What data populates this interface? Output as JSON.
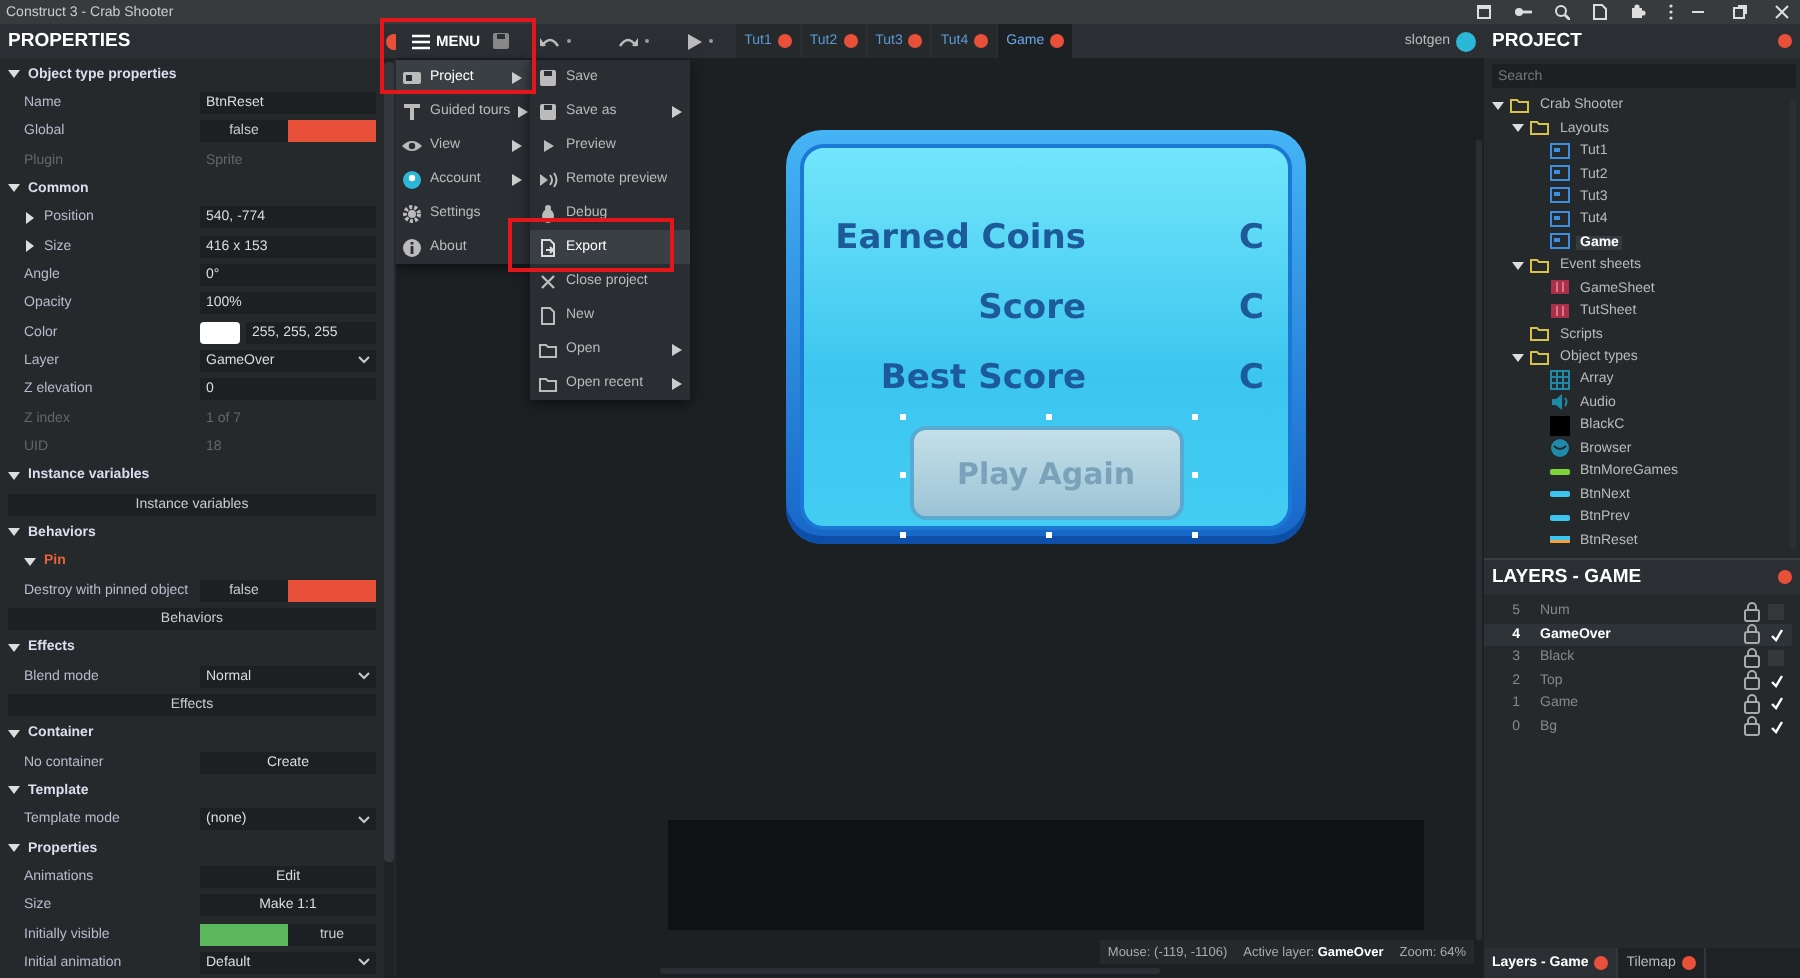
{
  "window": {
    "title": "Construct 3 - Crab Shooter"
  },
  "properties": {
    "title": "PROPERTIES",
    "sections": [
      {
        "title": "Object type properties",
        "expanded": true,
        "rows": [
          {
            "kind": "field",
            "label": "Name",
            "value": "BtnReset"
          },
          {
            "kind": "toggle",
            "label": "Global",
            "value": "false",
            "on": false
          },
          {
            "kind": "readonly",
            "label": "Plugin",
            "value": "Sprite"
          }
        ]
      },
      {
        "title": "Common",
        "expanded": true,
        "rows": [
          {
            "kind": "group",
            "label": "Position",
            "value": "540, -774",
            "expanded": false
          },
          {
            "kind": "group",
            "label": "Size",
            "value": "416 x 153",
            "expanded": false
          },
          {
            "kind": "field",
            "label": "Angle",
            "value": "0°"
          },
          {
            "kind": "field",
            "label": "Opacity",
            "value": "100%"
          },
          {
            "kind": "color",
            "label": "Color",
            "value": "255, 255, 255",
            "color": "#ffffff"
          },
          {
            "kind": "select",
            "label": "Layer",
            "value": "GameOver"
          },
          {
            "kind": "field",
            "label": "Z elevation",
            "value": "0"
          },
          {
            "kind": "readonly",
            "label": "Z index",
            "value": "1 of 7"
          },
          {
            "kind": "readonly",
            "label": "UID",
            "value": "18"
          }
        ]
      },
      {
        "title": "Instance variables",
        "expanded": true,
        "rows": [
          {
            "kind": "button",
            "value": "Instance variables"
          }
        ]
      },
      {
        "title": "Behaviors",
        "expanded": true,
        "rows": [
          {
            "kind": "behavior",
            "label": "Pin",
            "expanded": true
          },
          {
            "kind": "toggle",
            "label": "Destroy with pinned object",
            "value": "false",
            "on": false
          },
          {
            "kind": "button",
            "value": "Behaviors"
          }
        ]
      },
      {
        "title": "Effects",
        "expanded": true,
        "rows": [
          {
            "kind": "select",
            "label": "Blend mode",
            "value": "Normal"
          },
          {
            "kind": "button",
            "value": "Effects"
          }
        ]
      },
      {
        "title": "Container",
        "expanded": true,
        "rows": [
          {
            "kind": "action",
            "label": "No container",
            "value": "Create"
          }
        ]
      },
      {
        "title": "Template",
        "expanded": true,
        "rows": [
          {
            "kind": "select",
            "label": "Template mode",
            "value": "(none)"
          }
        ]
      },
      {
        "title": "Properties",
        "expanded": true,
        "rows": [
          {
            "kind": "action",
            "label": "Animations",
            "value": "Edit"
          },
          {
            "kind": "action",
            "label": "Size",
            "value": "Make 1:1"
          },
          {
            "kind": "toggle",
            "label": "Initially visible",
            "value": "true",
            "on": true
          },
          {
            "kind": "select",
            "label": "Initial animation",
            "value": "Default"
          }
        ]
      }
    ]
  },
  "toolbar": {
    "menu_label": "MENU",
    "tabs": [
      {
        "label": "Tut1",
        "selected": false
      },
      {
        "label": "Tut2",
        "selected": false
      },
      {
        "label": "Tut3",
        "selected": false
      },
      {
        "label": "Tut4",
        "selected": false
      },
      {
        "label": "Game",
        "selected": true
      }
    ],
    "user": "slotgen"
  },
  "main_menu": [
    {
      "kind": "project",
      "label": "Project",
      "submenu": true,
      "selected": true
    },
    {
      "kind": "tours",
      "label": "Guided tours",
      "submenu": true,
      "selected": false
    },
    {
      "kind": "view",
      "label": "View",
      "submenu": true,
      "selected": false
    },
    {
      "kind": "account",
      "label": "Account",
      "submenu": true,
      "selected": false
    },
    {
      "kind": "settings",
      "label": "Settings",
      "submenu": false,
      "selected": false
    },
    {
      "kind": "about",
      "label": "About",
      "submenu": false,
      "selected": false
    }
  ],
  "project_menu": [
    {
      "kind": "save",
      "label": "Save",
      "submenu": false,
      "selected": false
    },
    {
      "kind": "save",
      "label": "Save as",
      "submenu": true,
      "selected": false
    },
    {
      "kind": "preview",
      "label": "Preview",
      "submenu": false,
      "selected": false
    },
    {
      "kind": "remote",
      "label": "Remote preview",
      "submenu": false,
      "selected": false
    },
    {
      "kind": "debug",
      "label": "Debug",
      "submenu": false,
      "selected": false
    },
    {
      "kind": "export",
      "label": "Export",
      "submenu": false,
      "selected": true
    },
    {
      "kind": "close",
      "label": "Close project",
      "submenu": false,
      "selected": false
    },
    {
      "kind": "new",
      "label": "New",
      "submenu": false,
      "selected": false
    },
    {
      "kind": "open",
      "label": "Open",
      "submenu": true,
      "selected": false
    },
    {
      "kind": "open",
      "label": "Open recent",
      "submenu": true,
      "selected": false
    }
  ],
  "layout_view": {
    "rows": [
      {
        "label": "Earned Coins",
        "value": "C"
      },
      {
        "label": "Score",
        "value": "C"
      },
      {
        "label": "Best Score",
        "value": "C"
      }
    ],
    "button": "Play Again"
  },
  "status_bar": {
    "mouse": "Mouse: (-119, -1106)",
    "active_layer": "Active layer: **GameOver**",
    "zoom": "Zoom: 64%"
  },
  "project": {
    "title": "PROJECT",
    "search": {
      "placeholder": "Search"
    },
    "tree": [
      {
        "kind": "folder",
        "label": "Crab Shooter",
        "expanded": true,
        "selected": false,
        "children": [
          {
            "kind": "folder",
            "label": "Layouts",
            "expanded": true,
            "selected": false,
            "children": [
              {
                "kind": "layout",
                "label": "Tut1",
                "selected": false
              },
              {
                "kind": "layout",
                "label": "Tut2",
                "selected": false
              },
              {
                "kind": "layout",
                "label": "Tut3",
                "selected": false
              },
              {
                "kind": "layout",
                "label": "Tut4",
                "selected": false
              },
              {
                "kind": "layout",
                "label": "Game",
                "selected": true
              }
            ]
          },
          {
            "kind": "folder",
            "label": "Event sheets",
            "expanded": true,
            "selected": false,
            "children": [
              {
                "kind": "event_sheet",
                "label": "GameSheet",
                "selected": false
              },
              {
                "kind": "event_sheet",
                "label": "TutSheet",
                "selected": false
              }
            ]
          },
          {
            "kind": "folder",
            "label": "Scripts",
            "selected": false
          },
          {
            "kind": "folder",
            "label": "Object types",
            "expanded": true,
            "selected": false,
            "children": [
              {
                "kind": "array",
                "label": "Array",
                "selected": false
              },
              {
                "kind": "audio",
                "label": "Audio",
                "selected": false
              },
              {
                "kind": "black_sprite",
                "label": "BlackC",
                "selected": false
              },
              {
                "kind": "browser",
                "label": "Browser",
                "selected": false
              },
              {
                "kind": "green_button",
                "label": "BtnMoreGames",
                "selected": false
              },
              {
                "kind": "blue_button",
                "label": "BtnNext",
                "selected": false
              },
              {
                "kind": "blue_button",
                "label": "BtnPrev",
                "selected": false
              },
              {
                "kind": "orange_button",
                "label": "BtnReset",
                "selected": false
              }
            ]
          }
        ]
      }
    ]
  },
  "layers": {
    "title": "LAYERS - GAME",
    "rows": [
      {
        "index": "5",
        "name": "Num",
        "visible": false,
        "selected": false
      },
      {
        "index": "4",
        "name": "GameOver",
        "visible": true,
        "selected": true
      },
      {
        "index": "3",
        "name": "Black",
        "visible": false,
        "selected": false
      },
      {
        "index": "2",
        "name": "Top",
        "visible": true,
        "selected": false
      },
      {
        "index": "1",
        "name": "Game",
        "visible": true,
        "selected": false
      },
      {
        "index": "0",
        "name": "Bg",
        "visible": true,
        "selected": false
      }
    ]
  },
  "bottom_tabs": [
    {
      "label": "Layers - Game",
      "selected": true
    },
    {
      "label": "Tilemap",
      "selected": false
    }
  ]
}
